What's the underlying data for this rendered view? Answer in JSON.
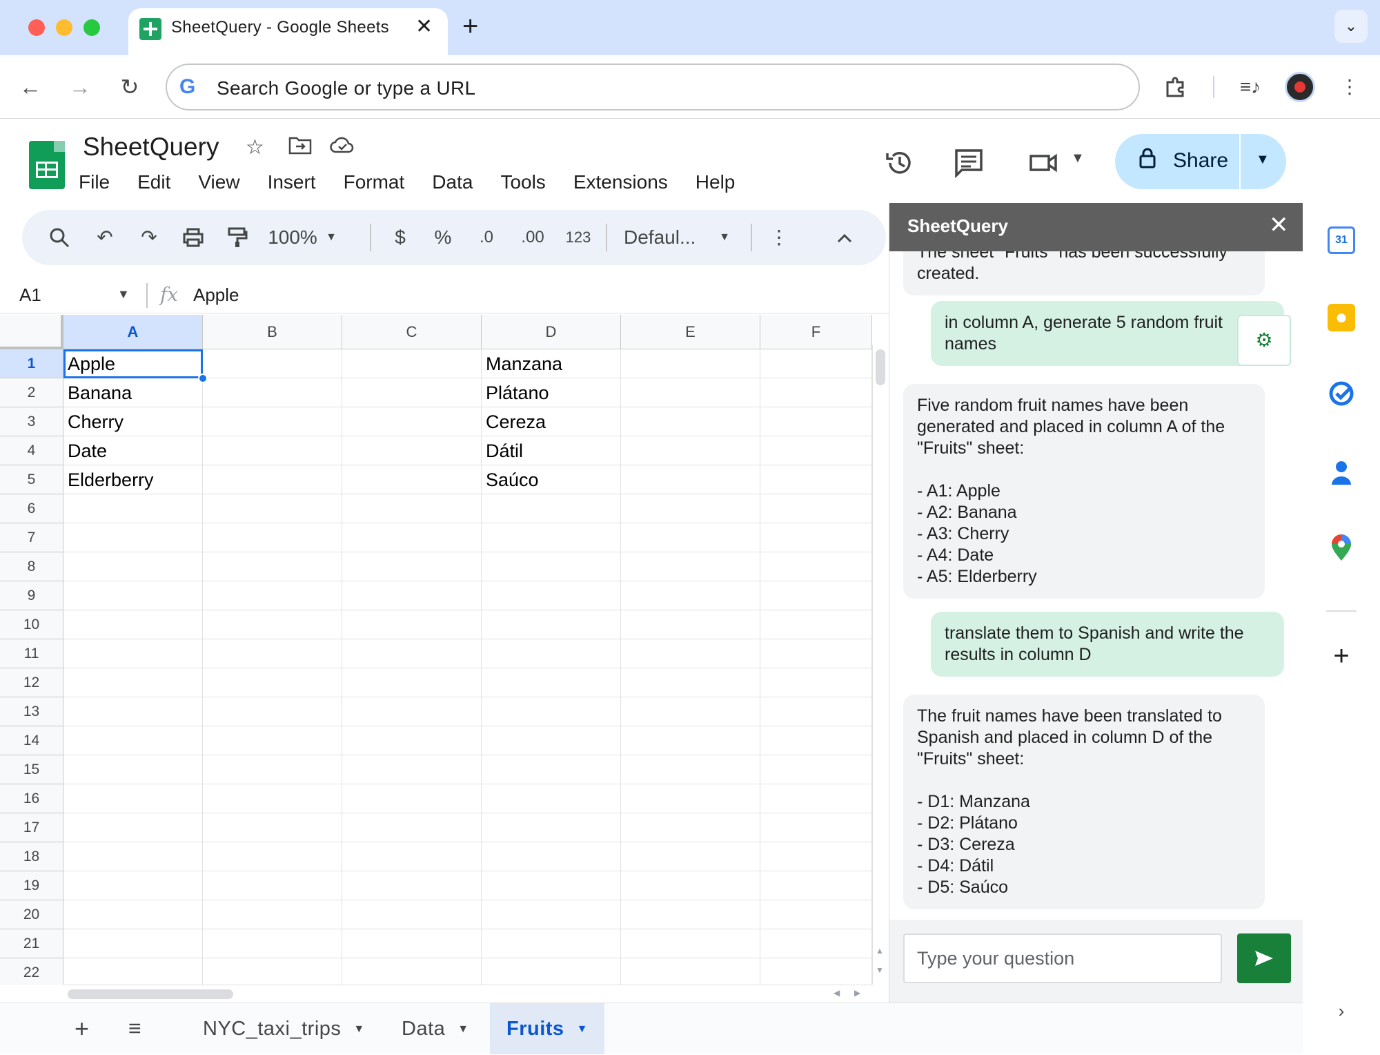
{
  "browser": {
    "tab_title": "SheetQuery - Google Sheets",
    "tab_close": "✕",
    "new_tab": "+",
    "omnibox_placeholder": "Search Google or type a URL",
    "google_g": "G"
  },
  "doc": {
    "title": "SheetQuery",
    "menus": [
      "File",
      "Edit",
      "View",
      "Insert",
      "Format",
      "Data",
      "Tools",
      "Extensions",
      "Help"
    ],
    "share_label": "Share"
  },
  "toolbar": {
    "zoom": "100%",
    "currency": "$",
    "percent": "%",
    "decrease_decimal": ".0",
    "increase_decimal": ".00",
    "number_format": "123",
    "font": "Defaul..."
  },
  "formula_bar": {
    "name_box": "A1",
    "fx": "fx",
    "value": "Apple"
  },
  "grid": {
    "columns": [
      "A",
      "B",
      "C",
      "D",
      "E",
      "F"
    ],
    "rows": [
      "1",
      "2",
      "3",
      "4",
      "5",
      "6",
      "7",
      "8",
      "9",
      "10",
      "11",
      "12",
      "13",
      "14",
      "15",
      "16",
      "17",
      "18",
      "19",
      "20",
      "21",
      "22"
    ],
    "col_a": [
      "Apple",
      "Banana",
      "Cherry",
      "Date",
      "Elderberry"
    ],
    "col_d": [
      "Manzana",
      "Plátano",
      "Cereza",
      "Dátil",
      "Saúco"
    ],
    "selected_cell": "A1"
  },
  "sheet_tabs": {
    "tabs": [
      "NYC_taxi_trips",
      "Data",
      "Fruits"
    ],
    "active": "Fruits"
  },
  "panel": {
    "title": "SheetQuery",
    "messages": [
      {
        "role": "bot",
        "text": "The sheet \"Fruits\" has been successfully\ncreated."
      },
      {
        "role": "user",
        "text": "in column A, generate 5 random fruit\nnames"
      },
      {
        "role": "bot",
        "text": "Five random fruit names have been\ngenerated and placed in column A of the\n\"Fruits\" sheet:\n\n- A1: Apple\n- A2: Banana\n- A3: Cherry\n- A4: Date\n- A5: Elderberry"
      },
      {
        "role": "user",
        "text": "translate them to Spanish and write the\nresults in column D"
      },
      {
        "role": "bot",
        "text": "The fruit names have been translated to\nSpanish and placed in column D of the\n\"Fruits\" sheet:\n\n- D1: Manzana\n- D2: Plátano\n- D3: Cereza\n- D4: Dátil\n- D5: Saúco"
      }
    ],
    "input_placeholder": "Type your question"
  },
  "rail": {
    "calendar_label": "31"
  },
  "colors": {
    "sheets_green": "#0f9d58",
    "share_bg": "#c2e7ff",
    "selection_blue": "#1a73e8",
    "panel_header": "#5f5f5f",
    "user_bubble": "#d4f1e3",
    "send_button": "#188038"
  }
}
